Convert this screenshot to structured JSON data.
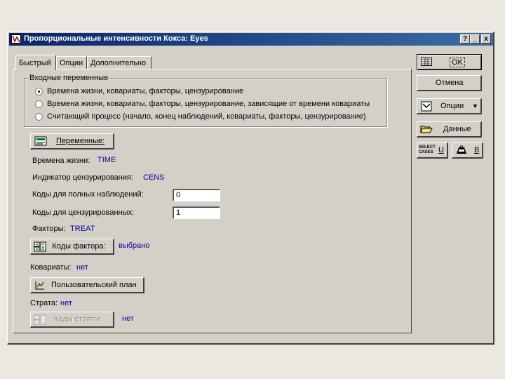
{
  "window": {
    "title": "Пропорциональные интенсивности Кокса: Eyes",
    "help_btn": "?",
    "min_btn": "_",
    "close_btn": "x"
  },
  "tabs": [
    {
      "label": "Быстрый",
      "active": true
    },
    {
      "label": "Опции",
      "active": false
    },
    {
      "label": "Дополнительно",
      "active": false
    }
  ],
  "input_vars": {
    "label": "Входные переменные",
    "options": [
      {
        "label": "Времена жизни, ковариаты, факторы, цензурирование",
        "selected": true
      },
      {
        "label": "Времена жизни, ковариаты, факторы, цензурирование, зависящие от времени ковариаты",
        "selected": false
      },
      {
        "label": "Считающий процесс (начало, конец наблюдений, ковариаты, факторы, цензурирование)",
        "selected": false
      }
    ]
  },
  "variables_button": "Переменные:",
  "lifetimes": {
    "label": "Времена жизни:",
    "value": "TIME"
  },
  "censor_indicator": {
    "label": "Индикатор цензурирования:",
    "value": "CENS"
  },
  "full_codes": {
    "label": "Коды для полных наблюдений:",
    "value": "0"
  },
  "censored_codes": {
    "label": "Коды для цензурированных:",
    "value": "1"
  },
  "factors": {
    "label": "Факторы:",
    "value": "TREAT"
  },
  "factor_codes": {
    "button": "Коды фактора:",
    "status": "выбрано"
  },
  "covariates": {
    "label": "Ковариаты:",
    "value": "нет"
  },
  "custom_plan_button": "Пользовательский план",
  "strata": {
    "label": "Страта:",
    "value": "нет"
  },
  "strata_codes": {
    "button": "Коды страты:",
    "status": "нет"
  },
  "right_panel": {
    "ok": "OK",
    "cancel": "Отмена",
    "options": "Опции",
    "data": "Данные",
    "select_cases_line1": "SELECT",
    "select_cases_line2": "CASES",
    "select_cases_key": "U",
    "weight_key": "B"
  }
}
